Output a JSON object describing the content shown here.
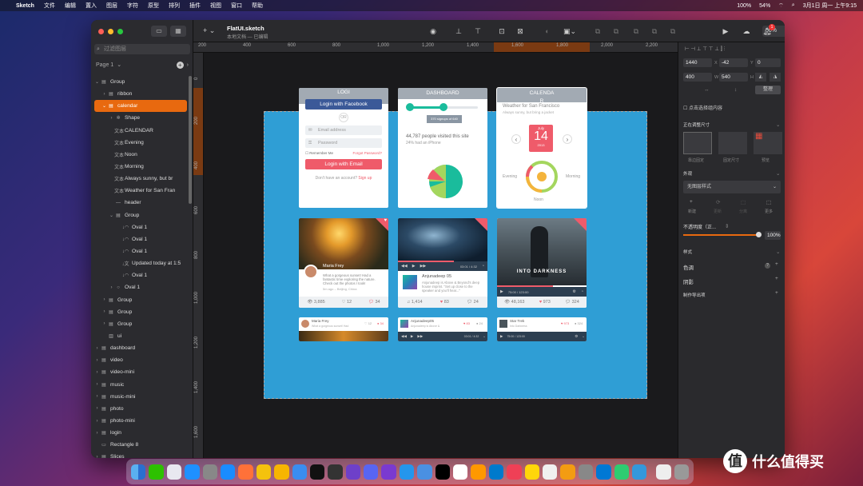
{
  "menubar": {
    "apple": "",
    "app": "Sketch",
    "items": [
      "文件",
      "编辑",
      "置入",
      "图层",
      "字符",
      "原型",
      "排列",
      "插件",
      "视图",
      "窗口",
      "帮助"
    ],
    "battery": "100%",
    "percent": "54%",
    "clock": "3月1日 周一 上午9:15"
  },
  "toolbar": {
    "title": "FlatUI.sketch",
    "subtitle": "本地文档 — 已编辑",
    "zoom": "50%",
    "add": "+",
    "notif_count": "1"
  },
  "sidebar": {
    "filter_placeholder": "过滤图层",
    "page": "Page 1"
  },
  "layers": [
    {
      "indent": 0,
      "caret": "⌄",
      "icon": "▤",
      "label": "Group"
    },
    {
      "indent": 1,
      "caret": "›",
      "icon": "▤",
      "label": "ribbon"
    },
    {
      "indent": 1,
      "caret": "⌄",
      "icon": "▤",
      "label": "calendar",
      "selected": true
    },
    {
      "indent": 2,
      "caret": "›",
      "icon": "✲",
      "label": "Shape"
    },
    {
      "indent": 2,
      "caret": "",
      "icon": "文本",
      "label": "CALENDAR"
    },
    {
      "indent": 2,
      "caret": "",
      "icon": "文本",
      "label": "Evening"
    },
    {
      "indent": 2,
      "caret": "",
      "icon": "文本",
      "label": "Noon"
    },
    {
      "indent": 2,
      "caret": "",
      "icon": "文本",
      "label": "Morning"
    },
    {
      "indent": 2,
      "caret": "",
      "icon": "文本",
      "label": "Always sunny, but br"
    },
    {
      "indent": 2,
      "caret": "",
      "icon": "文本",
      "label": "Weather for San Fran"
    },
    {
      "indent": 2,
      "caret": "",
      "icon": "—",
      "label": "header"
    },
    {
      "indent": 2,
      "caret": "⌄",
      "icon": "▤",
      "label": "Group"
    },
    {
      "indent": 3,
      "caret": "",
      "icon": "↓◠",
      "label": "Oval 1"
    },
    {
      "indent": 3,
      "caret": "",
      "icon": "↓◠",
      "label": "Oval 1"
    },
    {
      "indent": 3,
      "caret": "",
      "icon": "↓◠",
      "label": "Oval 1"
    },
    {
      "indent": 3,
      "caret": "",
      "icon": "↓文",
      "label": "Updated today at 1:5"
    },
    {
      "indent": 3,
      "caret": "",
      "icon": "↓◠",
      "label": "Oval 1"
    },
    {
      "indent": 2,
      "caret": "›",
      "icon": "○",
      "label": "Oval 1"
    },
    {
      "indent": 1,
      "caret": "›",
      "icon": "▤",
      "label": "Group"
    },
    {
      "indent": 1,
      "caret": "›",
      "icon": "▤",
      "label": "Group"
    },
    {
      "indent": 1,
      "caret": "›",
      "icon": "▤",
      "label": "Group"
    },
    {
      "indent": 1,
      "caret": "",
      "icon": "▥",
      "label": "ui"
    },
    {
      "indent": 0,
      "caret": "›",
      "icon": "▤",
      "label": "dashboard"
    },
    {
      "indent": 0,
      "caret": "›",
      "icon": "▤",
      "label": "video"
    },
    {
      "indent": 0,
      "caret": "›",
      "icon": "▤",
      "label": "video-mini"
    },
    {
      "indent": 0,
      "caret": "›",
      "icon": "▤",
      "label": "music"
    },
    {
      "indent": 0,
      "caret": "›",
      "icon": "▤",
      "label": "music-mini"
    },
    {
      "indent": 0,
      "caret": "›",
      "icon": "▤",
      "label": "photo"
    },
    {
      "indent": 0,
      "caret": "›",
      "icon": "▤",
      "label": "photo-mini"
    },
    {
      "indent": 0,
      "caret": "›",
      "icon": "▤",
      "label": "login"
    },
    {
      "indent": 0,
      "caret": "",
      "icon": "▭",
      "label": "Rectangle 8"
    },
    {
      "indent": 0,
      "caret": "›",
      "icon": "▤",
      "label": "Slices"
    }
  ],
  "ruler_h": [
    "200",
    "400",
    "600",
    "800",
    "1,000",
    "1,200",
    "1,400",
    "1,600",
    "1,800",
    "2,000",
    "2,200"
  ],
  "ruler_v": [
    "0",
    "200",
    "400",
    "600",
    "800",
    "1,000",
    "1,200",
    "1,400",
    "1,600"
  ],
  "login": {
    "head": "LOGI",
    "head2": "N",
    "fb": "Login with Facebook",
    "or": "OR",
    "email": "Email address",
    "password": "Password",
    "remember": "Remember Me",
    "forgot": "Forgot Password?",
    "email_btn": "Login with Email",
    "noacct": "Don't have an account?",
    "signup": "Sign up"
  },
  "dashboard": {
    "head": "DASHBOARD",
    "signups": "370 signups of 640",
    "visited": "44,787 people visited this site",
    "iphone": "24% had an iPhone"
  },
  "calendar": {
    "head": "CALENDA",
    "head2": "R",
    "weather": "Weather for San Francisco",
    "sunny": "Always sunny, but bring a jacket",
    "month": "July",
    "day": "14",
    "year": "2013",
    "evening": "Evening",
    "morning": "Morning",
    "noon": "Noon"
  },
  "photo": {
    "name": "Maria Frey",
    "text": "What a gorgeous sunset! Had a fantastic time exploring the nature. Check out the photos I took!",
    "meta": "5m ago – Beijing, China",
    "views": "3,885",
    "likes": "12",
    "comments": "34"
  },
  "music": {
    "time": "03:01 / 4:32",
    "name": "Anjunadeep 05",
    "text": "Anjunadeep is Above & Beyond's deep house imprint. \"Set up close to the speaker and you'll hear...\"",
    "plays": "1,414",
    "likes": "83",
    "comments": "24"
  },
  "video": {
    "title": "INTO DARKNESS",
    "time": "75:00 / 123:00",
    "views": "48,163",
    "likes": "973",
    "comments": "324"
  },
  "mini": {
    "photo_name": "Maria Frey",
    "photo_text": "What a gorgeous sunset! Had",
    "photo_likes": "12",
    "photo_comments": "34",
    "music_name": "Anjunadeep05",
    "music_text": "Anjunadeep is Above &",
    "music_likes": "83",
    "music_comments": "24",
    "music_time": "03:01 / 4:32",
    "video_name": "Star Trek",
    "video_text": "Into Darkness",
    "video_likes": "973",
    "video_comments": "324",
    "video_time": "75:00 / 123:00"
  },
  "inspector": {
    "x": "1440",
    "y": "-42",
    "r": "0",
    "w": "400",
    "h": "540",
    "btn": "整理",
    "clip": "点击选择组内容",
    "resize": "正在调整尺寸",
    "r1": "靠边固定",
    "r2": "固定尺寸",
    "r3": "预览",
    "appearance": "外观",
    "no_style": "无图层样式",
    "new": "新建",
    "update": "更新",
    "detach": "分离",
    "more": "更多",
    "opacity_label": "不透明度（正...",
    "opacity": "100%",
    "style": "样式",
    "tint": "色调",
    "shadow": "阴影",
    "export": "制作导出项"
  },
  "watermark": "什么值得买"
}
